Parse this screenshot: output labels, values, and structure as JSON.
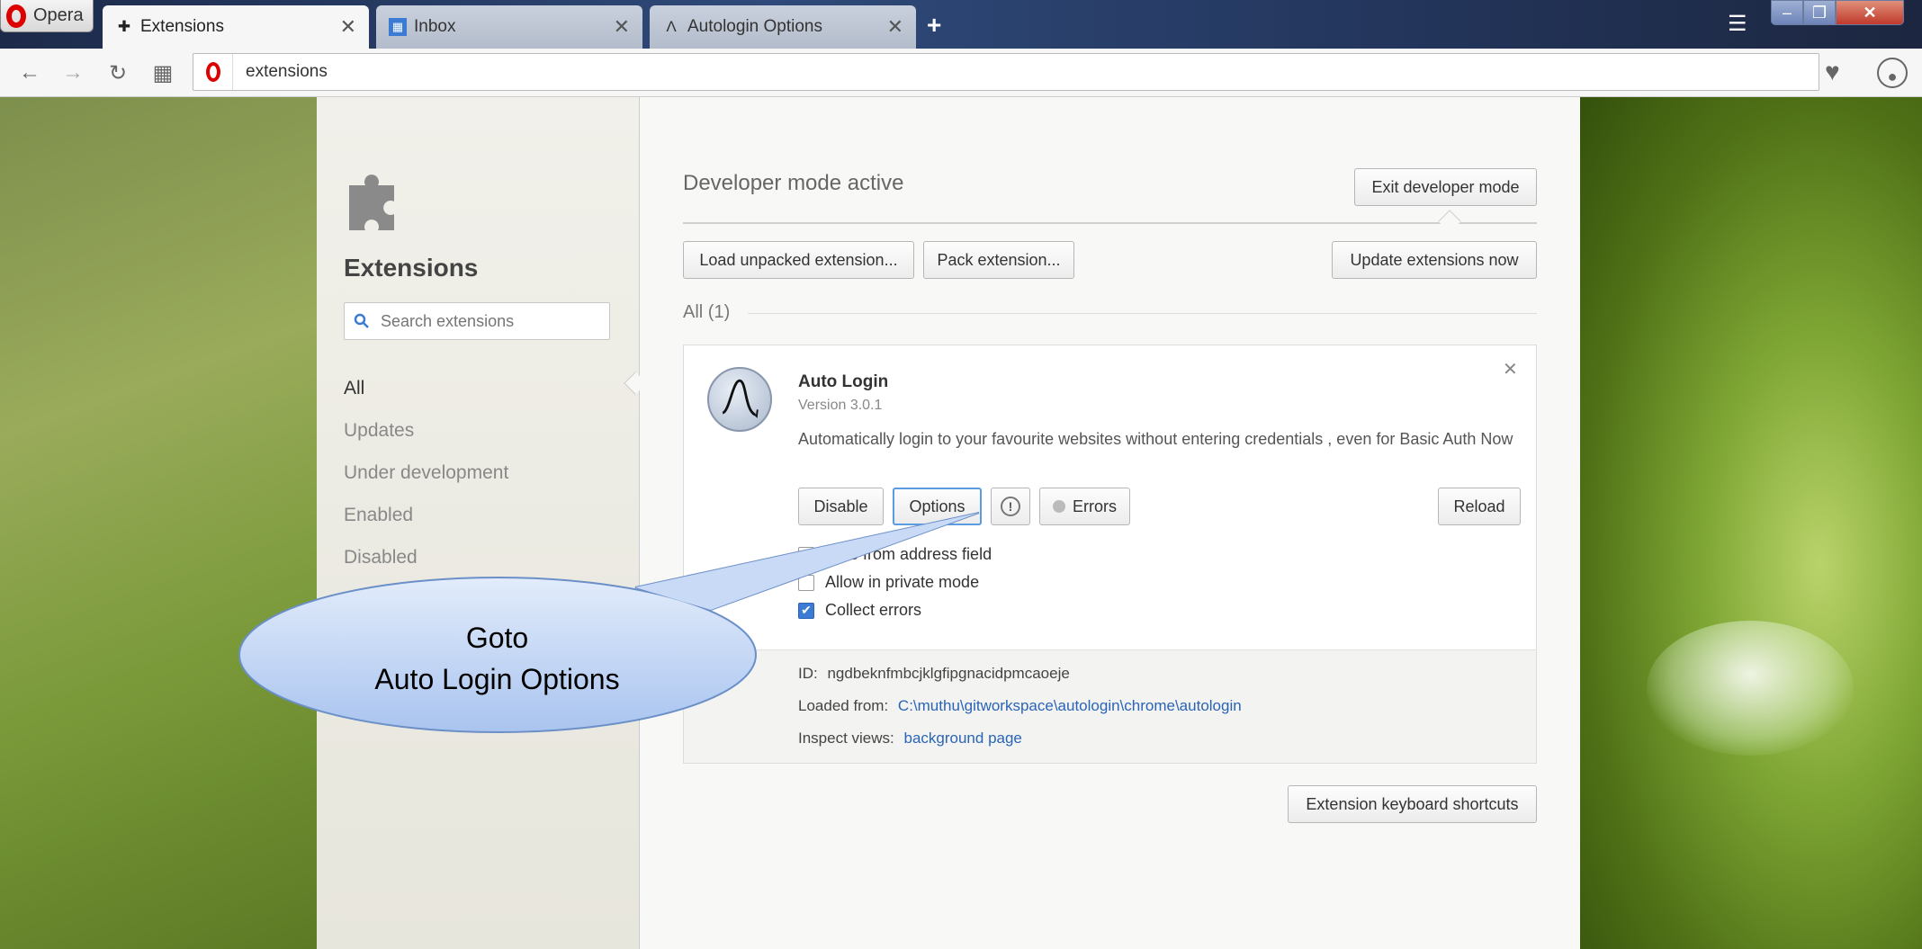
{
  "browser": {
    "menu_label": "Opera",
    "tabs": [
      {
        "label": "Extensions",
        "icon": "puzzle-icon",
        "active": true
      },
      {
        "label": "Inbox",
        "icon": "mail-icon",
        "active": false
      },
      {
        "label": "Autologin Options",
        "icon": "autologin-icon",
        "active": false
      }
    ],
    "address": "extensions"
  },
  "sidebar": {
    "title": "Extensions",
    "search_placeholder": "Search extensions",
    "items": [
      {
        "label": "All",
        "active": true
      },
      {
        "label": "Updates"
      },
      {
        "label": "Under development"
      },
      {
        "label": "Enabled"
      },
      {
        "label": "Disabled"
      }
    ]
  },
  "main": {
    "developer_mode_text": "Developer mode active",
    "exit_developer": "Exit developer mode",
    "load_unpacked": "Load unpacked extension...",
    "pack_extension": "Pack extension...",
    "update_now": "Update extensions now",
    "all_count": "All (1)",
    "keyboard_shortcuts": "Extension keyboard shortcuts"
  },
  "extension": {
    "name": "Auto Login",
    "version": "Version 3.0.1",
    "description": "Automatically login to your favourite websites without entering credentials , even for Basic Auth Now",
    "buttons": {
      "disable": "Disable",
      "options": "Options",
      "errors": "Errors",
      "reload": "Reload"
    },
    "checkboxes": [
      {
        "label": "Hide from address field",
        "checked": false
      },
      {
        "label": "Allow in private mode",
        "checked": false
      },
      {
        "label": "Collect errors",
        "checked": true
      }
    ],
    "id_label": "ID:",
    "id_value": "ngdbeknfmbcjklgfipgnacidpmcaoeje",
    "loaded_label": "Loaded from:",
    "loaded_value": "C:\\muthu\\gitworkspace\\autologin\\chrome\\autologin",
    "inspect_label": "Inspect views:",
    "inspect_value": "background page"
  },
  "callout": {
    "line1": "Goto",
    "line2": "Auto Login Options"
  },
  "colors": {
    "link": "#2a64b6",
    "checkbox_checked": "#3b7bd4",
    "opera_red": "#dd0000"
  }
}
